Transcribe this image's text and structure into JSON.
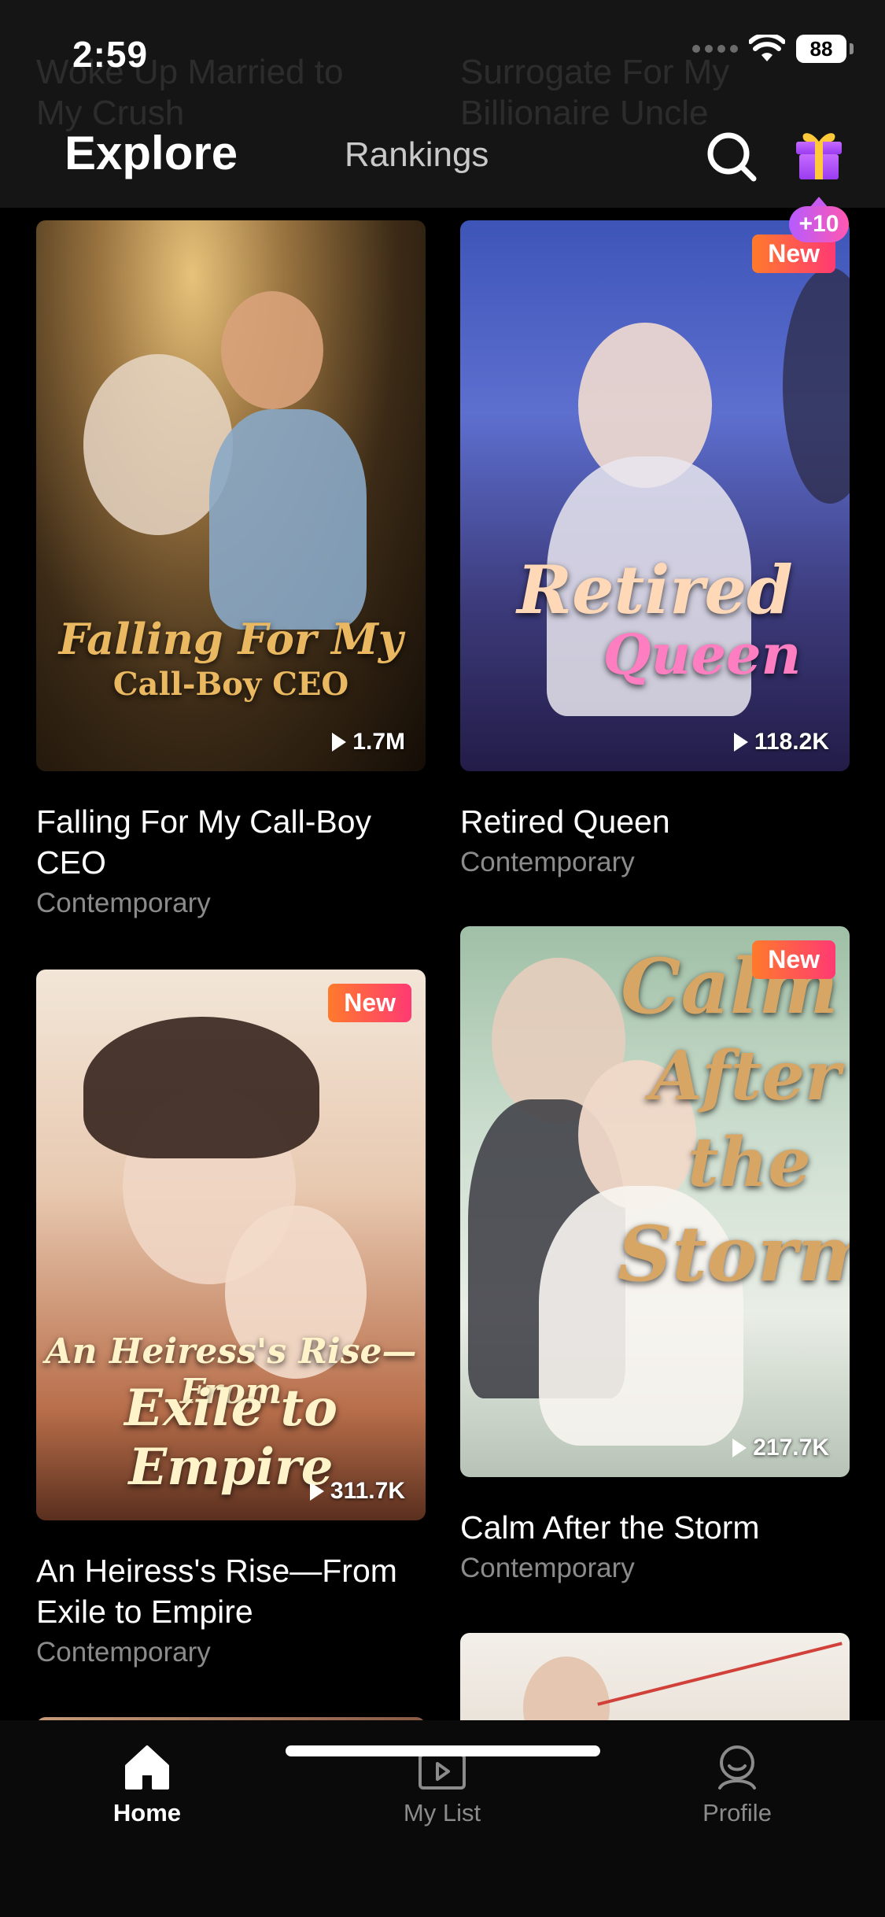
{
  "status_bar": {
    "time": "2:59",
    "battery": "88"
  },
  "header": {
    "ghost_titles": [
      "Woke Up Married to My Crush",
      "Surrogate For My Billionaire Uncle"
    ],
    "tabs": [
      {
        "label": "Explore",
        "active": true
      },
      {
        "label": "Rankings",
        "active": false
      }
    ],
    "gift_badge": "+10"
  },
  "feed": [
    {
      "title": "Falling For My Call-Boy CEO",
      "genre": "Contemporary",
      "views": "1.7M",
      "is_new": false,
      "poster_text": [
        "Falling For My",
        "Call-Boy CEO"
      ]
    },
    {
      "title": "Retired Queen",
      "genre": "Contemporary",
      "views": "118.2K",
      "is_new": true,
      "badge": "New",
      "poster_text": [
        "Retired",
        "Queen"
      ]
    },
    {
      "title": "An Heiress's Rise—From Exile to Empire",
      "genre": "Contemporary",
      "views": "311.7K",
      "is_new": true,
      "badge": "New",
      "poster_text": [
        "An Heiress's Rise—From",
        "Exile to Empire"
      ]
    },
    {
      "title": "Calm After the Storm",
      "genre": "Contemporary",
      "views": "217.7K",
      "is_new": true,
      "badge": "New",
      "poster_text": [
        "Calm",
        "After",
        "the",
        "Storm"
      ]
    }
  ],
  "bottom_nav": [
    {
      "label": "Home",
      "icon": "home-icon",
      "active": true
    },
    {
      "label": "My List",
      "icon": "my-list-icon",
      "active": false
    },
    {
      "label": "Profile",
      "icon": "profile-icon",
      "active": false
    }
  ],
  "colors": {
    "background": "#000000",
    "accent_gradient": [
      "#ff7a2c",
      "#ff3a73"
    ],
    "inactive_text": "#8b8b8b"
  }
}
